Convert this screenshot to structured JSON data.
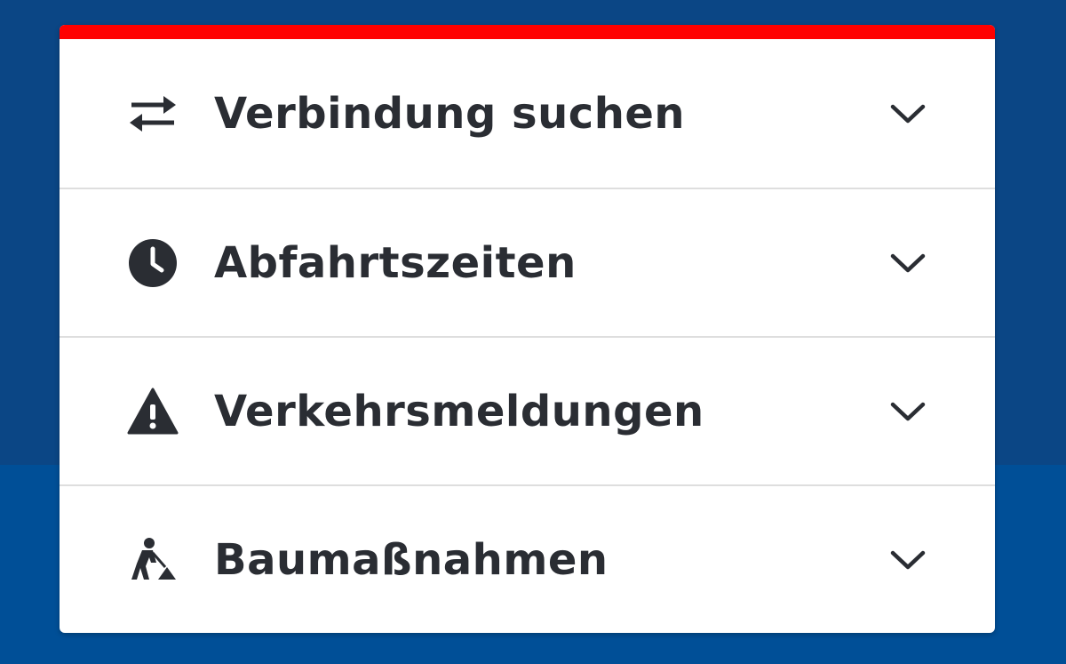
{
  "colors": {
    "background_top": "#0b4685",
    "background_bottom": "#004f97",
    "accent": "#ff0000",
    "text": "#2a2d33",
    "divider": "#dedede"
  },
  "menu": {
    "items": [
      {
        "label": "Verbindung suchen",
        "icon": "swap-arrows-icon",
        "expanded": false
      },
      {
        "label": "Abfahrtszeiten",
        "icon": "clock-icon",
        "expanded": false
      },
      {
        "label": "Verkehrsmeldungen",
        "icon": "warning-icon",
        "expanded": false
      },
      {
        "label": "Baumaßnahmen",
        "icon": "construction-worker-icon",
        "expanded": false
      }
    ]
  }
}
